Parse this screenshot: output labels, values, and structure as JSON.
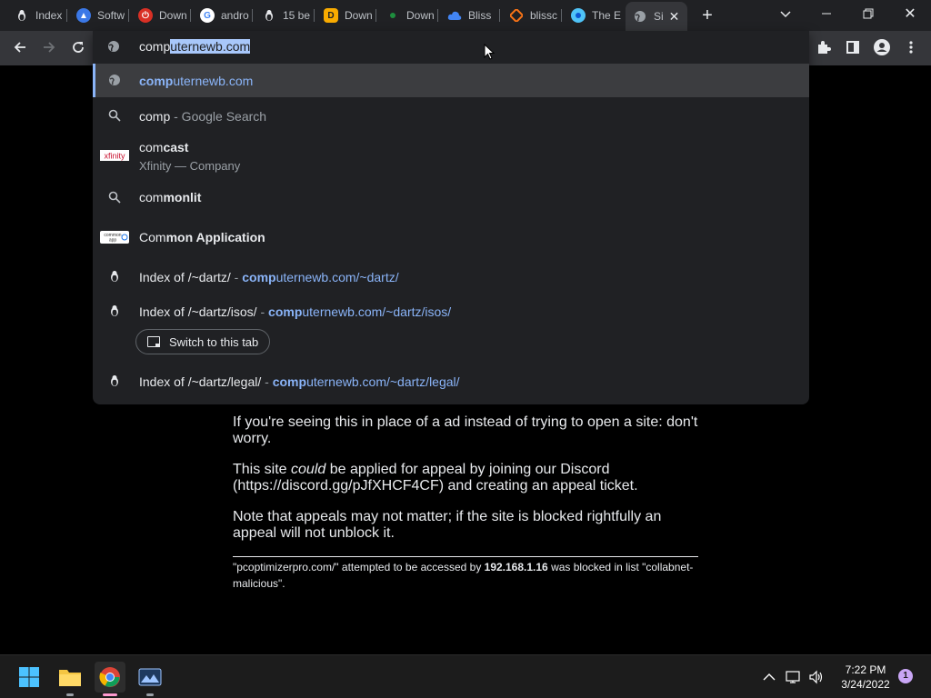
{
  "tabs": [
    {
      "title": "Index",
      "icon": "linux-penguin-icon",
      "color": "#5f6368"
    },
    {
      "title": "Softw",
      "icon": "software-logo-icon",
      "color": "#3b78e7"
    },
    {
      "title": "Down",
      "icon": "power-icon",
      "color": "#d93025"
    },
    {
      "title": "andro",
      "icon": "google-icon",
      "color": "#ffffff"
    },
    {
      "title": "15 be",
      "icon": "linux-penguin-icon",
      "color": "#5f6368"
    },
    {
      "title": "Down",
      "icon": "download-logo-icon",
      "color": "#f9ab00"
    },
    {
      "title": "Down",
      "icon": "dot-icon",
      "color": "#1e8e3e"
    },
    {
      "title": "Bliss",
      "icon": "cloud-icon",
      "color": "#4285f4"
    },
    {
      "title": "blissc",
      "icon": "git-icon",
      "color": "#f97316"
    },
    {
      "title": "The E",
      "icon": "edge-icon",
      "color": "#4fc3f7"
    },
    {
      "title": "Si",
      "icon": "globe-icon",
      "color": "#9aa0a6"
    }
  ],
  "omnibox": {
    "input_typed": "comp",
    "input_autocomplete": "uternewb.com",
    "suggestions": [
      {
        "bold": "comp",
        "rest": "uternewb.com"
      },
      {
        "typed": "comp",
        "suffix": " - Google Search"
      },
      {
        "typed": "com",
        "bold": "cast",
        "subtitle": "Xfinity — Company",
        "logo": "xfinity"
      },
      {
        "typed": "com",
        "bold": "monlit"
      },
      {
        "typed": "Com",
        "bold": "mon Application",
        "logo": "common app"
      },
      {
        "title": "Index of /~dartz/",
        "sep": " - ",
        "url_bold": "comp",
        "url_rest": "uternewb.com/~dartz/"
      },
      {
        "title": "Index of /~dartz/isos/",
        "sep": " - ",
        "url_bold": "comp",
        "url_rest": "uternewb.com/~dartz/isos/"
      },
      {
        "title": "Index of /~dartz/legal/",
        "sep": " - ",
        "url_bold": "comp",
        "url_rest": "uternewb.com/~dartz/legal/"
      }
    ],
    "switch_tab_label": "Switch to this tab"
  },
  "page": {
    "p1": "If you're seeing this in place of a ad instead of trying to open a site: don't worry.",
    "p2_pre": "This site ",
    "p2_em": "could",
    "p2_post": " be applied for appeal by joining our Discord (https://discord.gg/pJfXHCF4CF) and creating an appeal ticket.",
    "p3": "Note that appeals may not matter; if the site is blocked rightfully an appeal will not unblock it.",
    "foot_pre": "\"pcoptimizerpro.com/\" attempted to be accessed by ",
    "foot_ip": "192.168.1.16",
    "foot_post": " was blocked in list \"collabnet-malicious\"."
  },
  "taskbar": {
    "time": "7:22 PM",
    "date": "3/24/2022",
    "notification_count": "1"
  }
}
